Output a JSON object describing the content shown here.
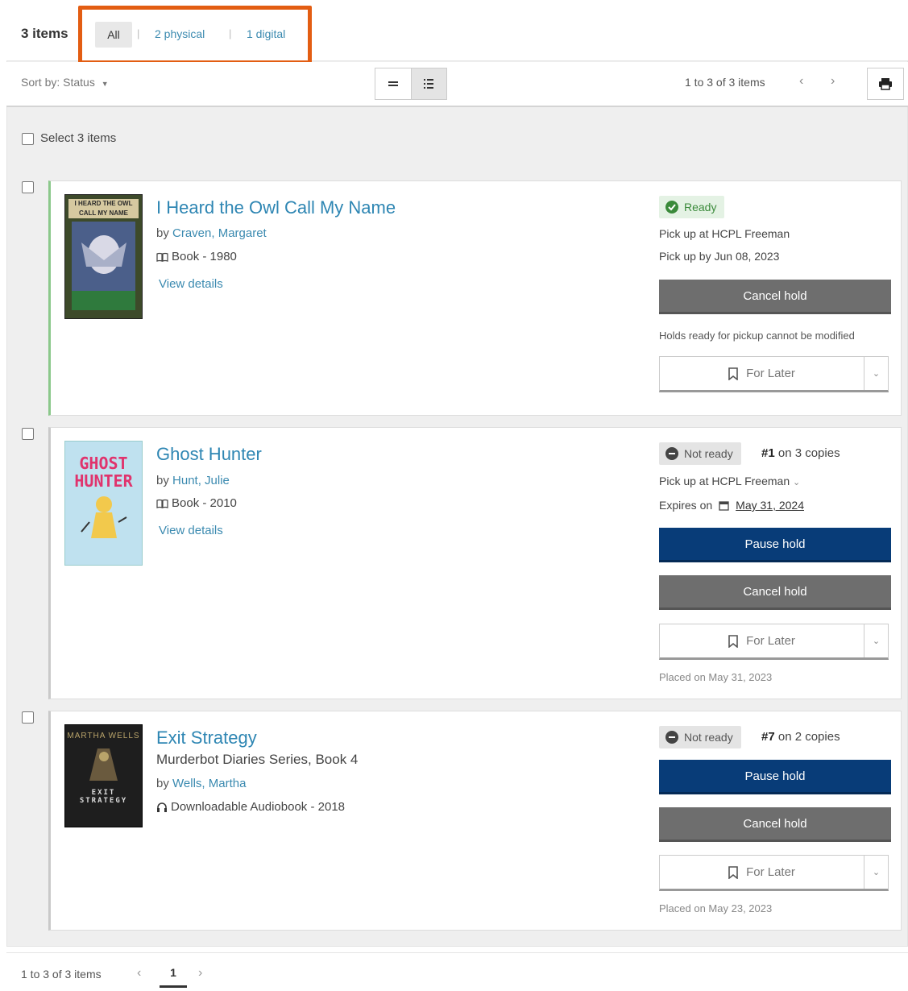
{
  "header": {
    "item_count": "3 items",
    "tabs": {
      "all": "All",
      "physical": "2 physical",
      "digital": "1 digital",
      "separator": "|"
    }
  },
  "toolbar": {
    "sort_label": "Sort by: Status",
    "range_text": "1 to 3 of 3 items",
    "prev": "‹",
    "next": "›"
  },
  "select_all_label": "Select 3 items",
  "holds": [
    {
      "title": "I Heard the Owl Call My Name",
      "by": "by ",
      "author": "Craven, Margaret",
      "format": "Book - 1980",
      "view_details": "View details",
      "status": "Ready",
      "pickup_location": "Pick up at HCPL Freeman",
      "pickup_by": "Pick up by Jun 08, 2023",
      "cancel_label": "Cancel hold",
      "note": "Holds ready for pickup cannot be modified",
      "for_later_label": "For Later",
      "cover_text": "I HEARD THE OWL CALL MY NAME"
    },
    {
      "title": "Ghost Hunter",
      "by": "by ",
      "author": "Hunt, Julie",
      "format": "Book - 2010",
      "view_details": "View details",
      "status": "Not ready",
      "queue_rank": "#1",
      "queue_rest": " on 3 copies",
      "pickup_location": "Pick up at HCPL Freeman",
      "expires_label": "Expires on",
      "expires_date": "May 31, 2024",
      "pause_label": "Pause hold",
      "cancel_label": "Cancel hold",
      "for_later_label": "For Later",
      "placed": "Placed on May 31, 2023",
      "cover_text_1": "GHOST",
      "cover_text_2": "HUNTER"
    },
    {
      "title": "Exit Strategy",
      "subtitle": "Murderbot Diaries Series, Book 4",
      "by": "by ",
      "author": "Wells, Martha",
      "format": "Downloadable Audiobook - 2018",
      "status": "Not ready",
      "queue_rank": "#7",
      "queue_rest": " on 2 copies",
      "pause_label": "Pause hold",
      "cancel_label": "Cancel hold",
      "for_later_label": "For Later",
      "placed": "Placed on May 23, 2023",
      "cover_text_1": "MARTHA WELLS",
      "cover_text_2": "EXIT STRATEGY"
    }
  ],
  "footer": {
    "range_text": "1 to 3 of 3 items",
    "prev": "‹",
    "page": "1",
    "next": "›"
  },
  "colors": {
    "highlight": "#e35d12",
    "link": "#2e86b3",
    "navy": "#083c78",
    "gray_button": "#6e6e6e",
    "ready_green": "#3a8a3a"
  }
}
